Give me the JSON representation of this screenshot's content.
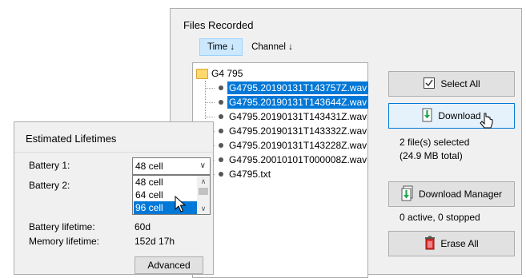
{
  "files_recorded": {
    "title": "Files Recorded",
    "sort_tabs": [
      {
        "label": "Time ↓",
        "active": true
      },
      {
        "label": "Channel ↓",
        "active": false
      }
    ],
    "tree": {
      "root": "G4 795",
      "items": [
        {
          "label": "G4795.20190131T143757Z.wav",
          "selected": true
        },
        {
          "label": "G4795.20190131T143644Z.wav",
          "selected": true
        },
        {
          "label": "G4795.20190131T143431Z.wav",
          "selected": false
        },
        {
          "label": "G4795.20190131T143332Z.wav",
          "selected": false
        },
        {
          "label": "G4795.20190131T143228Z.wav",
          "selected": false
        },
        {
          "label": "G4795.20010101T000008Z.wav",
          "selected": false
        },
        {
          "label": "G4795.txt",
          "selected": false
        }
      ]
    },
    "select_all_label": "Select All",
    "download_label": "Download",
    "selection_info": "2 file(s) selected",
    "selection_size": "(24.9 MB total)",
    "download_manager_label": "Download Manager",
    "download_status": "0 active, 0 stopped",
    "erase_all_label": "Erase All"
  },
  "lifetimes": {
    "title": "Estimated Lifetimes",
    "battery1_label": "Battery 1:",
    "battery1_value": "48 cell",
    "battery2_label": "Battery 2:",
    "options": [
      "48 cell",
      "64 cell",
      "96 cell"
    ],
    "highlighted_option": "96 cell",
    "battery_lifetime_label": "Battery lifetime:",
    "battery_lifetime_value": "60d",
    "memory_lifetime_label": "Memory lifetime:",
    "memory_lifetime_value": "152d 17h",
    "advanced_label": "Advanced"
  },
  "colors": {
    "selection": "#0078d7",
    "panel_bg": "#f0f0f0",
    "tab_active": "#cce8ff"
  }
}
